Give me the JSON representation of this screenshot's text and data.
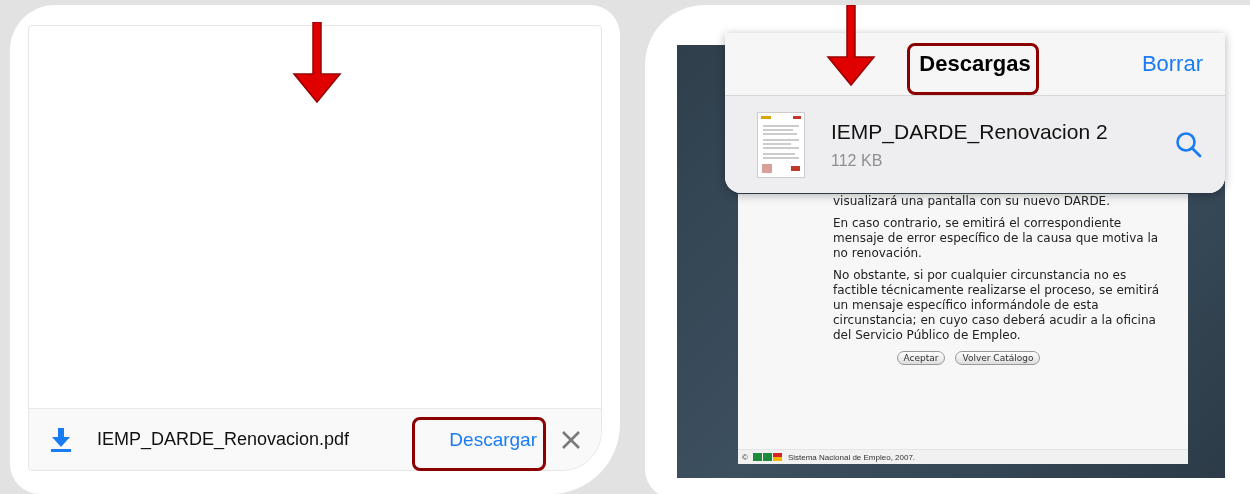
{
  "left_screen": {
    "download_bar": {
      "file_name": "IEMP_DARDE_Renovacion.pdf",
      "download_button": "Descargar"
    }
  },
  "right_screen": {
    "downloads_popup": {
      "title": "Descargas",
      "clear_button": "Borrar",
      "items": [
        {
          "name": "IEMP_DARDE_Renovacion 2",
          "size": "112 KB"
        }
      ]
    },
    "document": {
      "paragraphs": [
        "visualizará una pantalla con su nuevo DARDE.",
        "En caso contrario, se emitirá el correspondiente mensaje de error específico de la causa que motiva la no renovación.",
        "No obstante, si por cualquier circunstancia no es factible técnicamente realizarse el proceso, se emitirá un mensaje específico informándole de esta circunstancia; en cuyo caso deberá acudir a la oficina del Servicio Público de Empleo."
      ],
      "buttons": [
        "Aceptar",
        "Volver Catálogo"
      ],
      "footer_copyright": "©",
      "footer": "Sistema Nacional de Empleo, 2007."
    }
  }
}
